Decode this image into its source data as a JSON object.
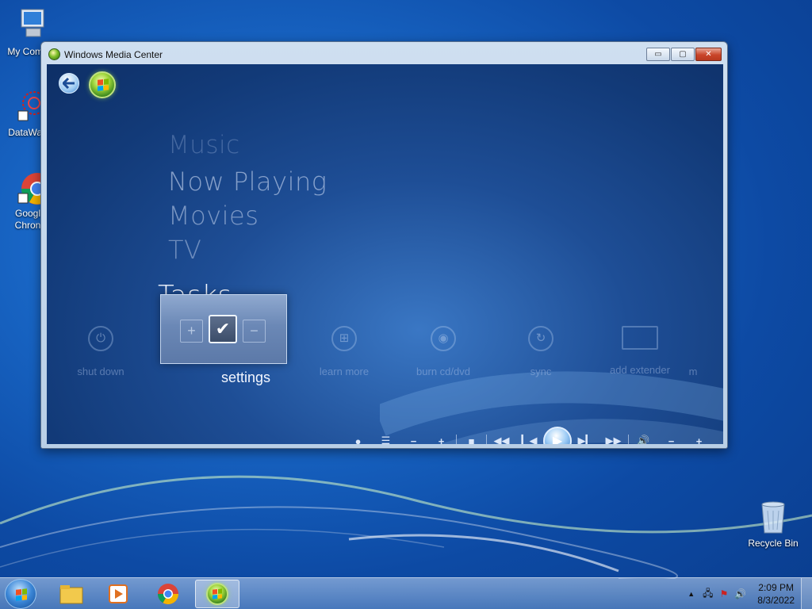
{
  "desktop": {
    "icons": [
      {
        "label": "My Comp"
      },
      {
        "label": "DataWag"
      },
      {
        "label_line1": "Googl",
        "label_line2": "Chron"
      },
      {
        "label": "Recycle Bin"
      }
    ]
  },
  "window": {
    "title": "Windows Media Center",
    "caption": {
      "minimize": "▭",
      "maximize": "▢",
      "close": "✕"
    }
  },
  "wmc": {
    "menu": [
      "Music",
      "Now Playing",
      "Movies",
      "TV"
    ],
    "current_section": "Tasks",
    "tasks": [
      {
        "label": "shut down",
        "icon": "power-icon"
      },
      {
        "label": "settings",
        "icon": "checkmark-icon"
      },
      {
        "label": "learn more",
        "icon": "windows-flag-icon"
      },
      {
        "label": "burn cd/dvd",
        "icon": "disc-icon"
      },
      {
        "label": "sync",
        "icon": "sync-icon"
      },
      {
        "label": "add extender",
        "icon": "monitor-icon"
      },
      {
        "label": "m",
        "icon": ""
      }
    ],
    "transport": [
      "record",
      "guide",
      "channel-down",
      "channel-up",
      "stop",
      "rewind",
      "previous",
      "play",
      "next",
      "fast-forward",
      "mute",
      "volume-down",
      "volume-up"
    ]
  },
  "taskbar": {
    "clock_time": "2:09 PM",
    "clock_date": "8/3/2022"
  },
  "colors": {
    "desktop": "#1865c4",
    "wmc_bg": "#1e4e96",
    "accent": "#9ed53a"
  }
}
